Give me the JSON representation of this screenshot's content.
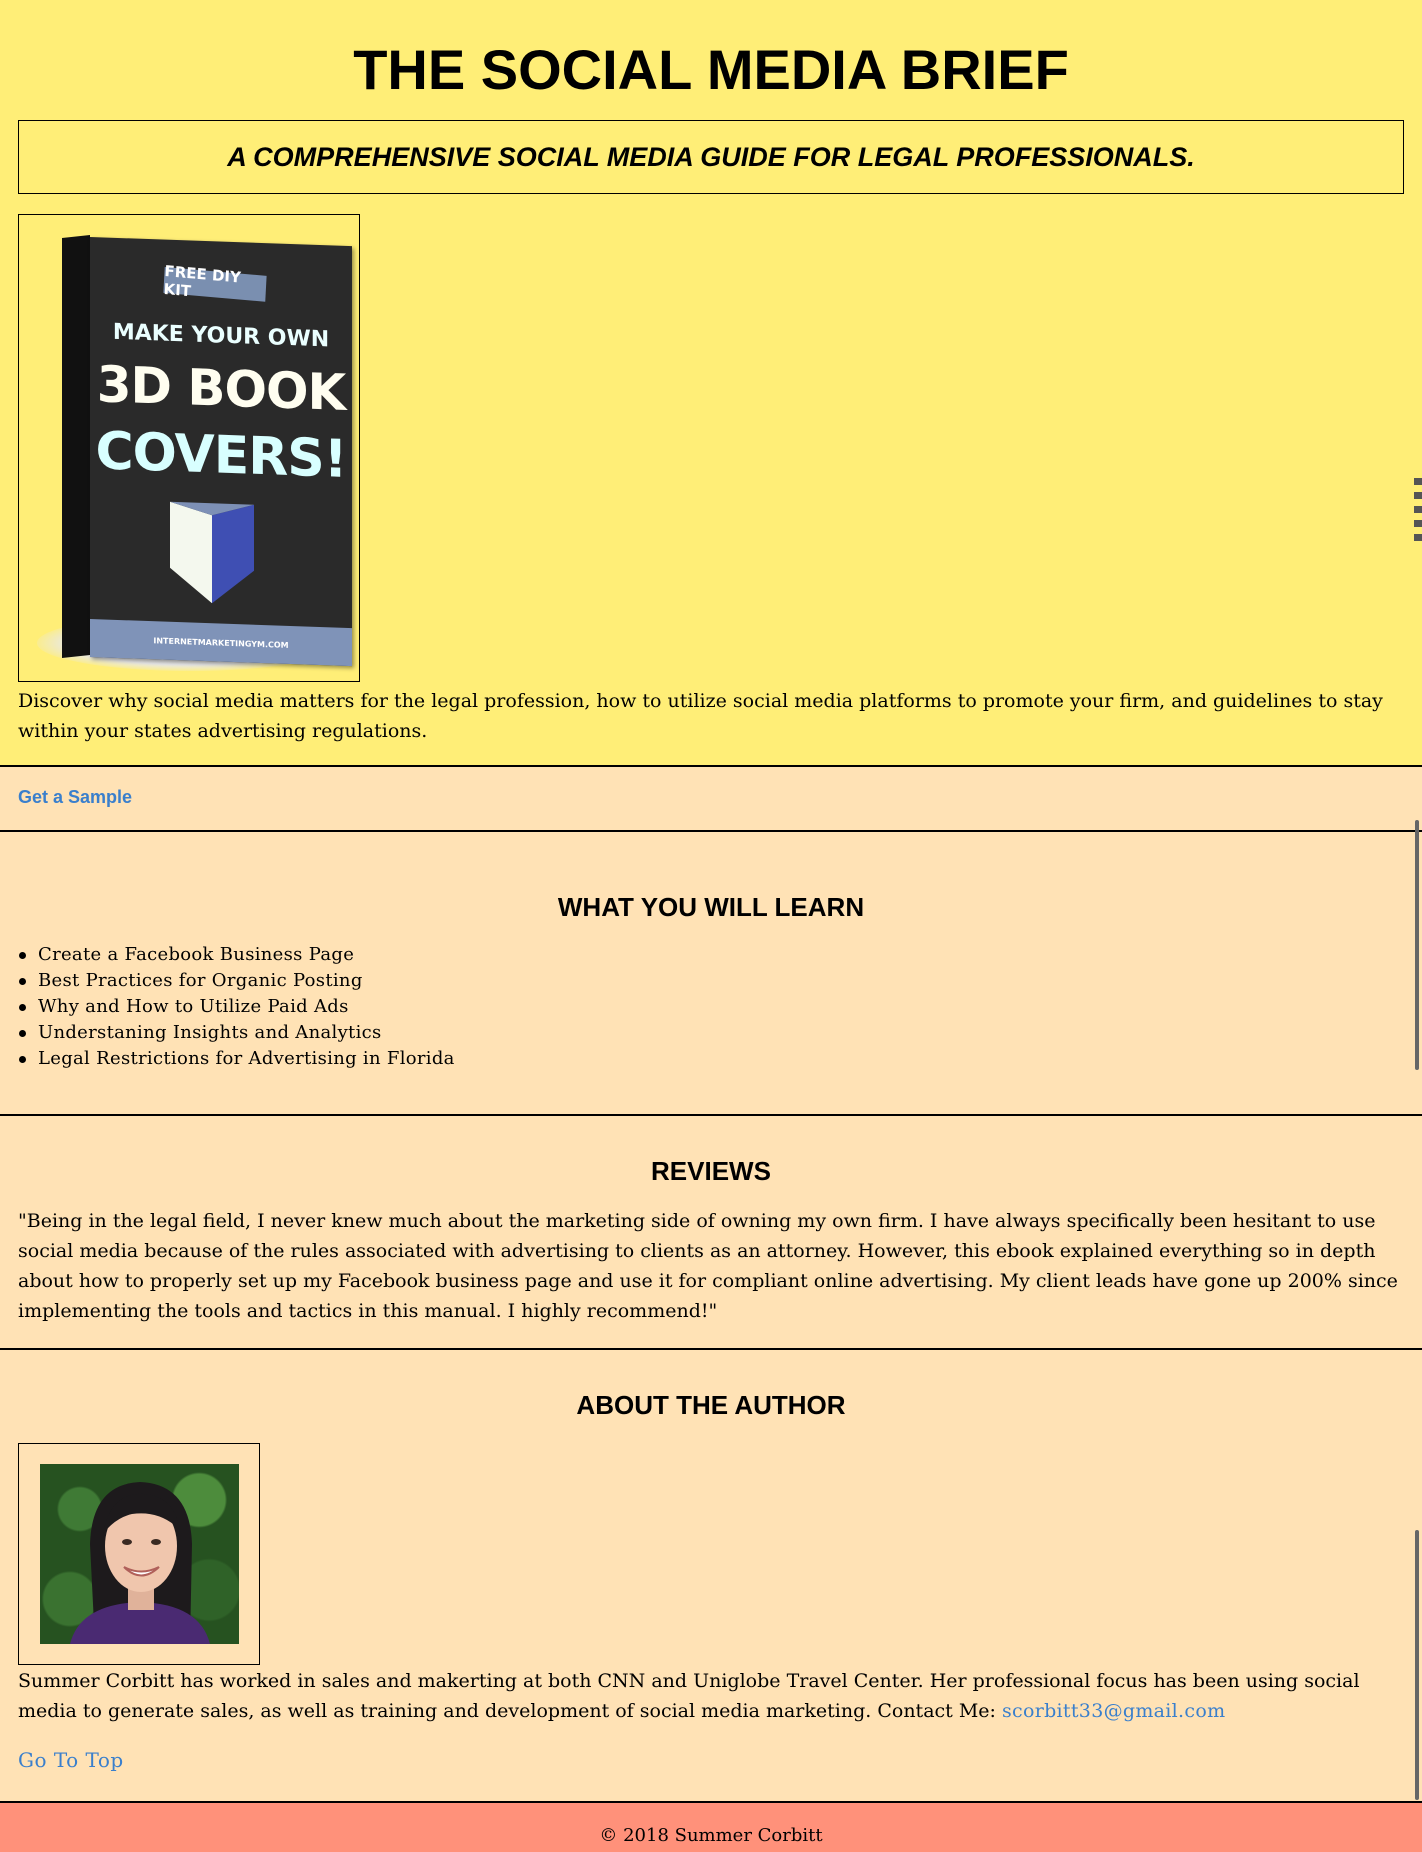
{
  "header": {
    "title": "THE SOCIAL MEDIA BRIEF",
    "tagline": "A COMPREHENSIVE SOCIAL MEDIA GUIDE FOR LEGAL PROFESSIONALS."
  },
  "book_cover": {
    "badge": "FREE DIY KIT",
    "line1": "MAKE YOUR OWN",
    "line2": "3D BOOK",
    "line3": "COVERS!",
    "footer": "INTERNETMARKETINGYM.COM"
  },
  "intro": "Discover why social media matters for the legal profession, how to utilize social media platforms to promote your firm, and guidelines to stay within your states advertising regulations.",
  "cta": {
    "sample_label": "Get a Sample"
  },
  "learn": {
    "heading": "WHAT YOU WILL LEARN",
    "items": [
      "Create a Facebook Business Page",
      "Best Practices for Organic Posting",
      "Why and How to Utilize Paid Ads",
      "Understaning Insights and Analytics",
      "Legal Restrictions for Advertising in Florida"
    ]
  },
  "reviews": {
    "heading": "REVIEWS",
    "text": "\"Being in the legal field, I never knew much about the marketing side of owning my own firm. I have always specifically been hesitant to use social media because of the rules associated with advertising to clients as an attorney. However, this ebook explained everything so in depth about how to properly set up my Facebook business page and use it for compliant online advertising. My client leads have gone up 200% since implementing the tools and tactics in this manual. I highly recommend!\""
  },
  "author": {
    "heading": "ABOUT THE AUTHOR",
    "bio": "Summer Corbitt has worked in sales and makerting at both CNN and Uniglobe Travel Center. Her professional focus has been using social media to generate sales, as well as training and development of social media marketing. Contact Me: ",
    "email": "scorbitt33@gmail.com",
    "top_link": "Go To Top"
  },
  "footer": {
    "copyright": "© 2018 Summer Corbitt"
  },
  "colors": {
    "hero_bg": "#ffee77",
    "section_bg": "#ffe2b5",
    "footer_bg": "#ff917a",
    "link": "#3a7fcc"
  }
}
